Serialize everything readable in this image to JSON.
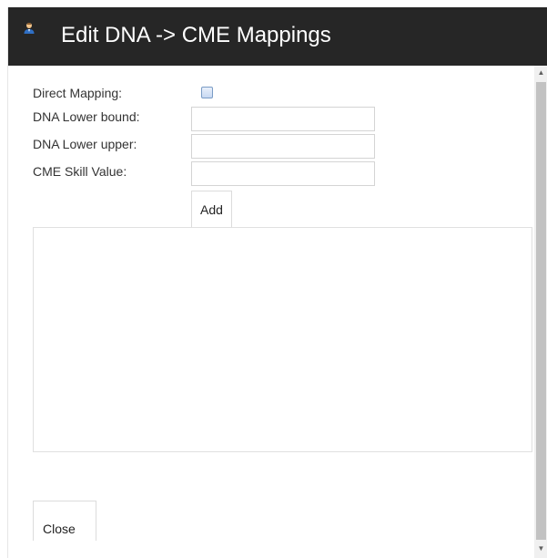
{
  "dialog": {
    "title": "Edit DNA -> CME Mappings",
    "icon": "user-icon"
  },
  "form": {
    "direct_mapping_label": "Direct Mapping:",
    "direct_mapping_checked": false,
    "lower_bound_label": "DNA Lower bound:",
    "lower_bound_value": "",
    "lower_upper_label": "DNA Lower upper:",
    "lower_upper_value": "",
    "cme_skill_label": "CME Skill Value:",
    "cme_skill_value": "",
    "add_label": "Add"
  },
  "mappings": {
    "items": []
  },
  "footer": {
    "close_label": "Close"
  },
  "scrollbar": {
    "up_arrow": "▲",
    "down_arrow": "▼"
  }
}
